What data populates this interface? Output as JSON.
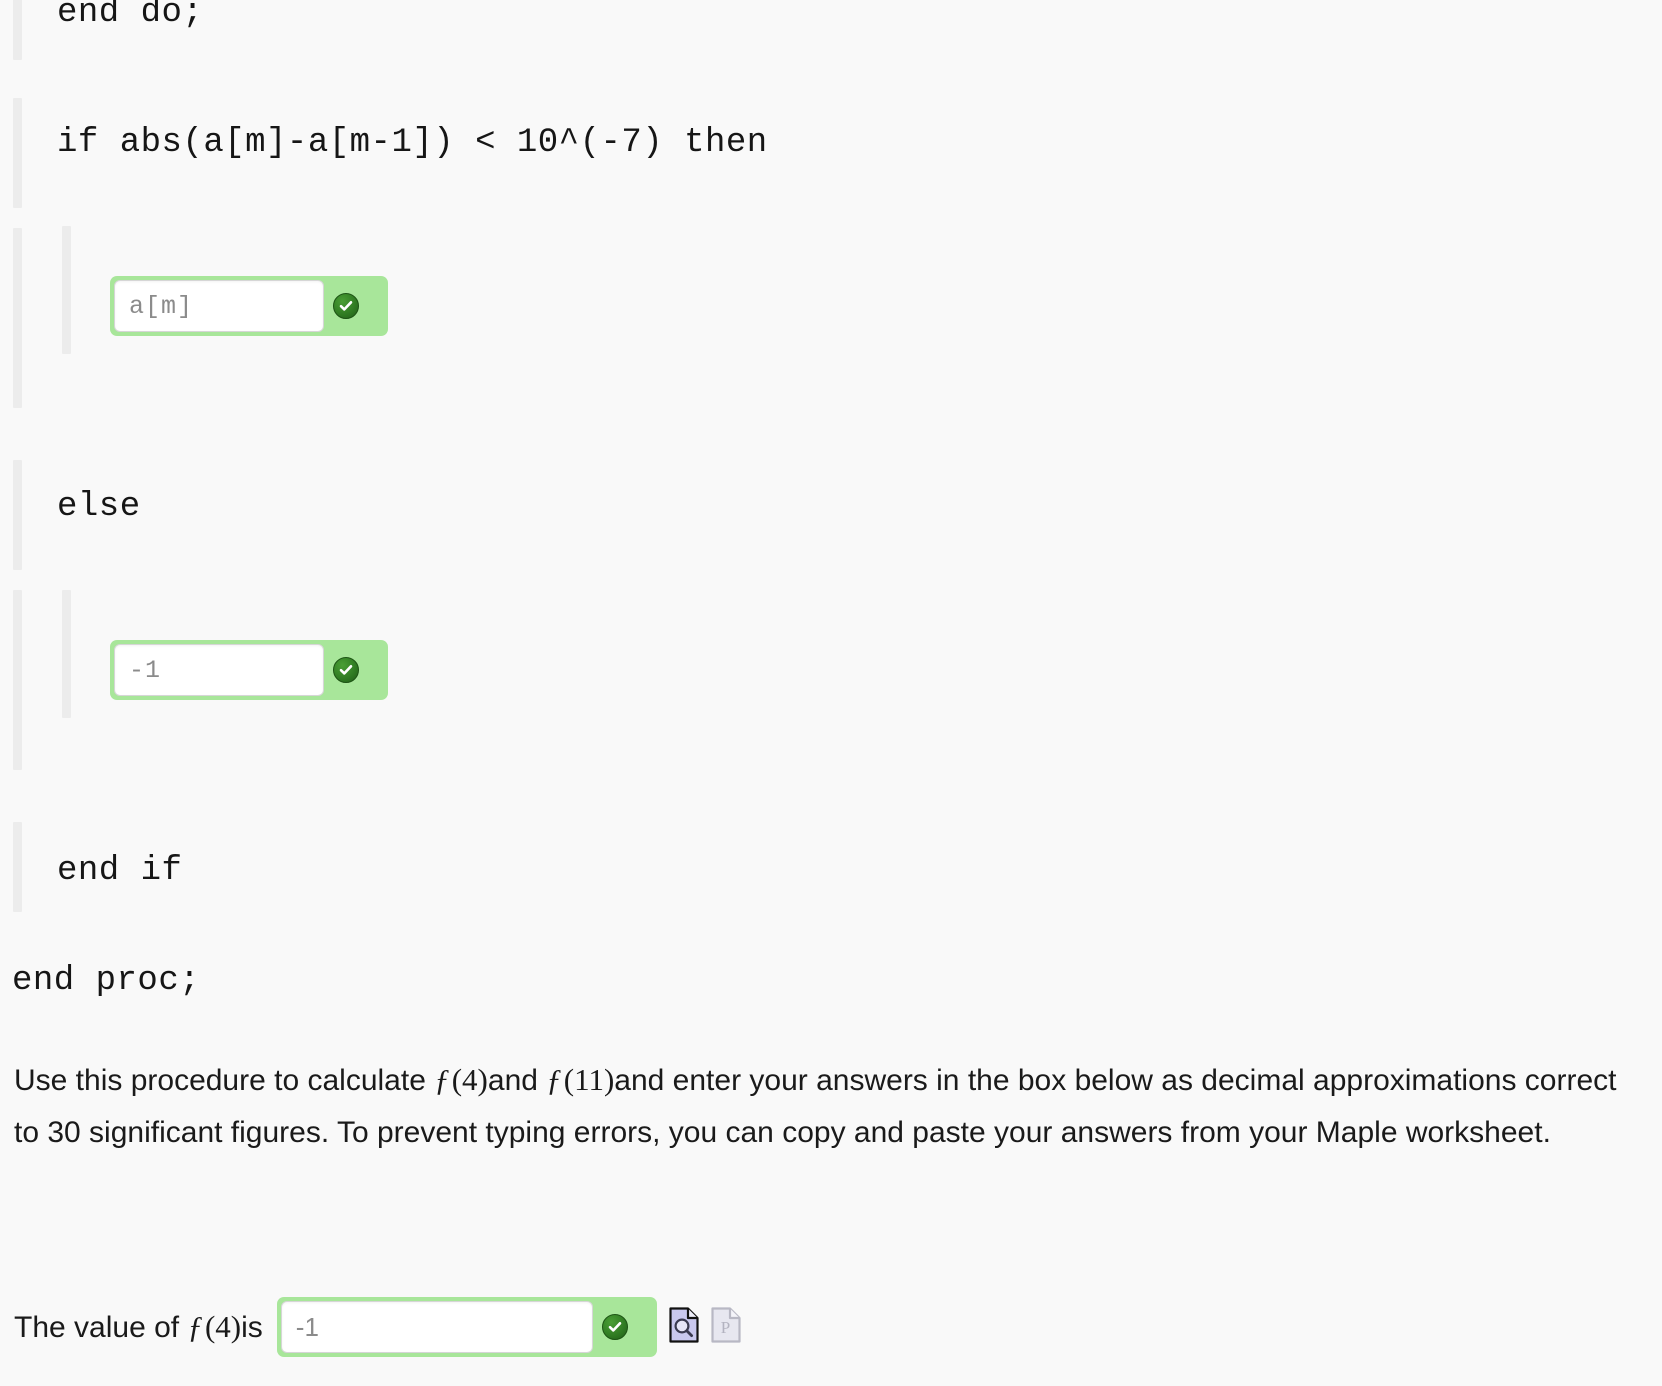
{
  "code_lines": [
    {
      "text": "end do;"
    },
    {
      "text": "if abs(a[m]-a[m-1]) < 10^(-7) then"
    },
    {
      "text": "else"
    },
    {
      "text": "end if"
    },
    {
      "text": "end proc;"
    }
  ],
  "answer_boxes": [
    {
      "value": "a[m]",
      "status": "correct"
    },
    {
      "value": "-1",
      "status": "correct"
    }
  ],
  "instructions": {
    "line1_a": "Use this procedure to calculate",
    "math1_f": "ƒ",
    "math1_arg": "(4)",
    "line1_b": "and",
    "math2_f": "ƒ",
    "math2_arg": "(11)",
    "line1_c": "and enter your answers in the box below as decimal",
    "line2": "approximations correct to 30 significant figures. To prevent typing errors, you can copy and paste your",
    "line3": "answers from your Maple worksheet."
  },
  "final_answer": {
    "label_a": "The value of",
    "label_math_f": "ƒ",
    "label_math_arg": "(4)",
    "label_b": "is",
    "value": "-1",
    "status": "correct",
    "preview_icon": "document-magnifier-icon",
    "print_icon": "document-p-icon"
  },
  "colors": {
    "background": "#f9f9f9",
    "guide_bar": "#ececec",
    "valid_green": "#a8e69a",
    "check_green": "#2f7a22",
    "placeholder_gray": "#8b8b8b",
    "text": "#161616"
  }
}
